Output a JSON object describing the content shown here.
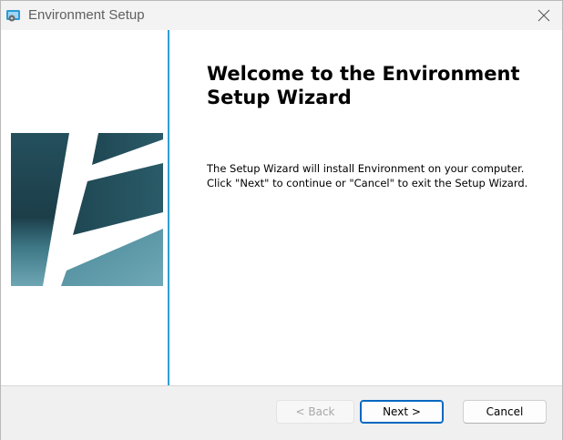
{
  "window": {
    "title": "Environment Setup"
  },
  "icons": {
    "app": "installer-icon",
    "close": "close-icon",
    "logo": "environment-logo"
  },
  "main": {
    "heading": "Welcome to the Environment Setup Wizard",
    "description_lines": [
      "The Setup Wizard will install Environment on your computer.",
      "Click \"Next\" to continue or \"Cancel\" to exit the Setup Wizard."
    ]
  },
  "buttons": {
    "back": {
      "label": "< Back",
      "enabled": false
    },
    "next": {
      "label": "Next >",
      "enabled": true,
      "default": true
    },
    "cancel": {
      "label": "Cancel",
      "enabled": true
    }
  },
  "colors": {
    "accent": "#2d9fd6",
    "logo_dark": "#173a45",
    "logo_light": "#6fa8b6",
    "focus_border": "#0067c0"
  }
}
